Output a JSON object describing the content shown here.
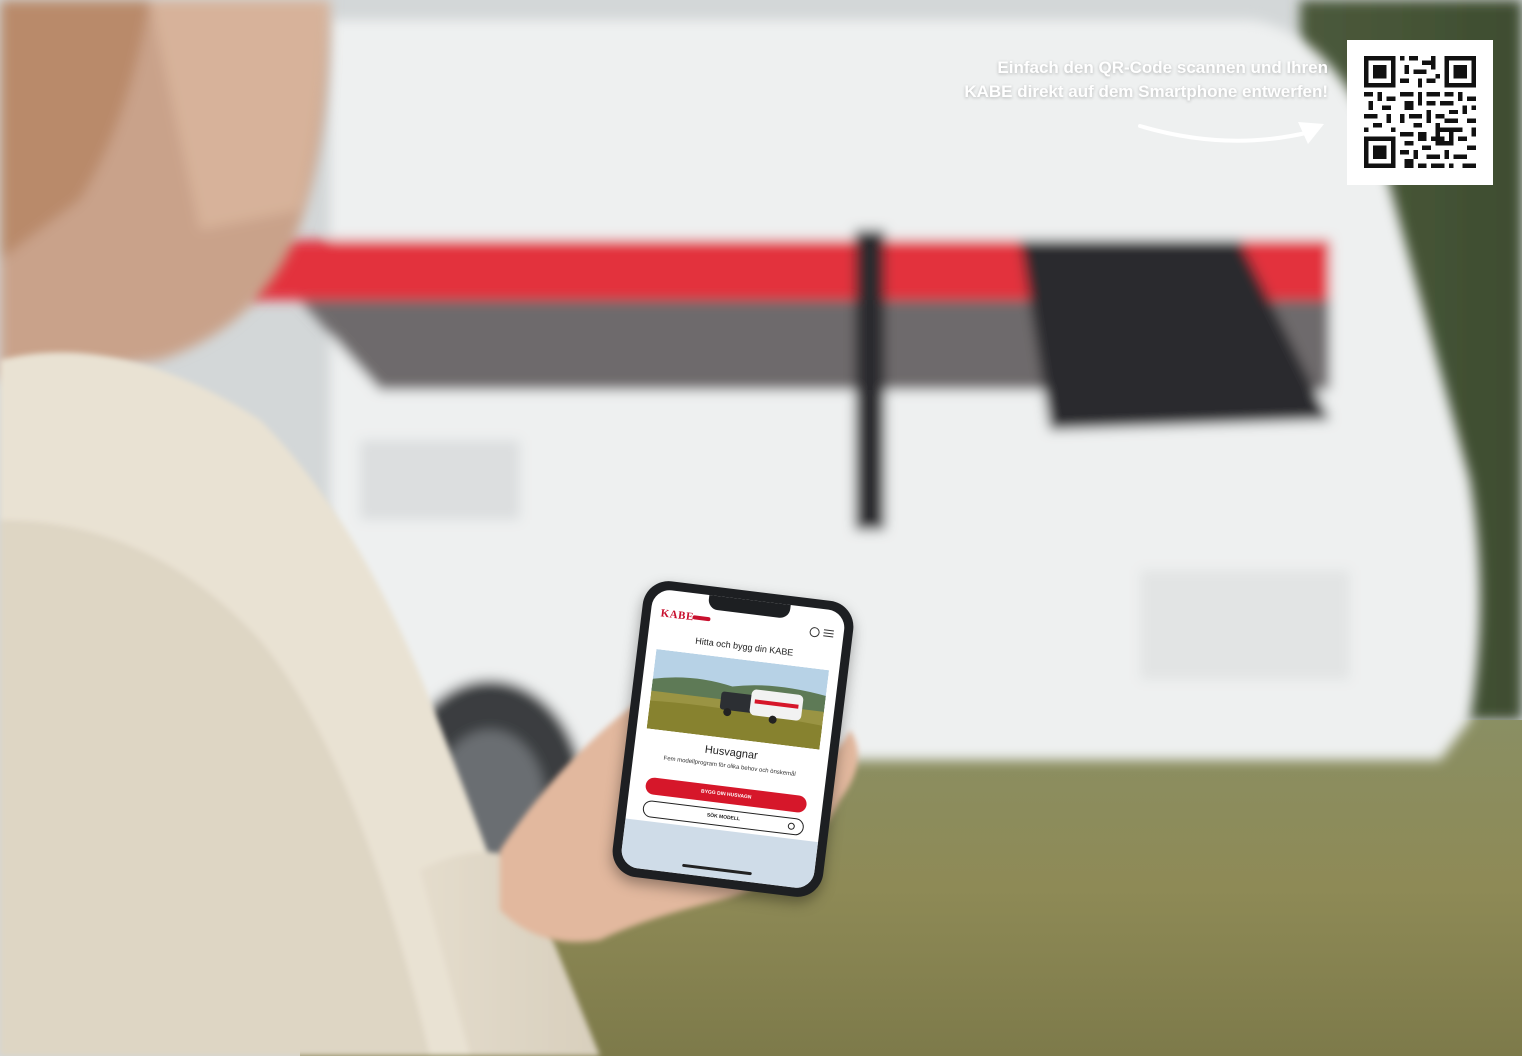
{
  "overlay": {
    "caption_line1": "Einfach den QR-Code scannen und Ihren",
    "caption_line2": "KABE direkt auf dem Smartphone entwerfen!",
    "arrow_icon": "curved-arrow-right-icon",
    "qr_icon": "qr-code-icon"
  },
  "phone_screen": {
    "brand": "KABE",
    "globe_icon": "globe-icon",
    "menu_icon": "hamburger-menu-icon",
    "heading": "Hitta och bygg din KABE",
    "product_title": "Husvagnar",
    "product_description": "Fem modellprogram för olika behov och önskemål",
    "primary_button": "BYGG DIN HUSVAGN",
    "secondary_button": "SÖK MODELL",
    "search_icon": "search-icon"
  },
  "colors": {
    "accent_red": "#d6172a",
    "overlay_text": "#ffffff"
  }
}
